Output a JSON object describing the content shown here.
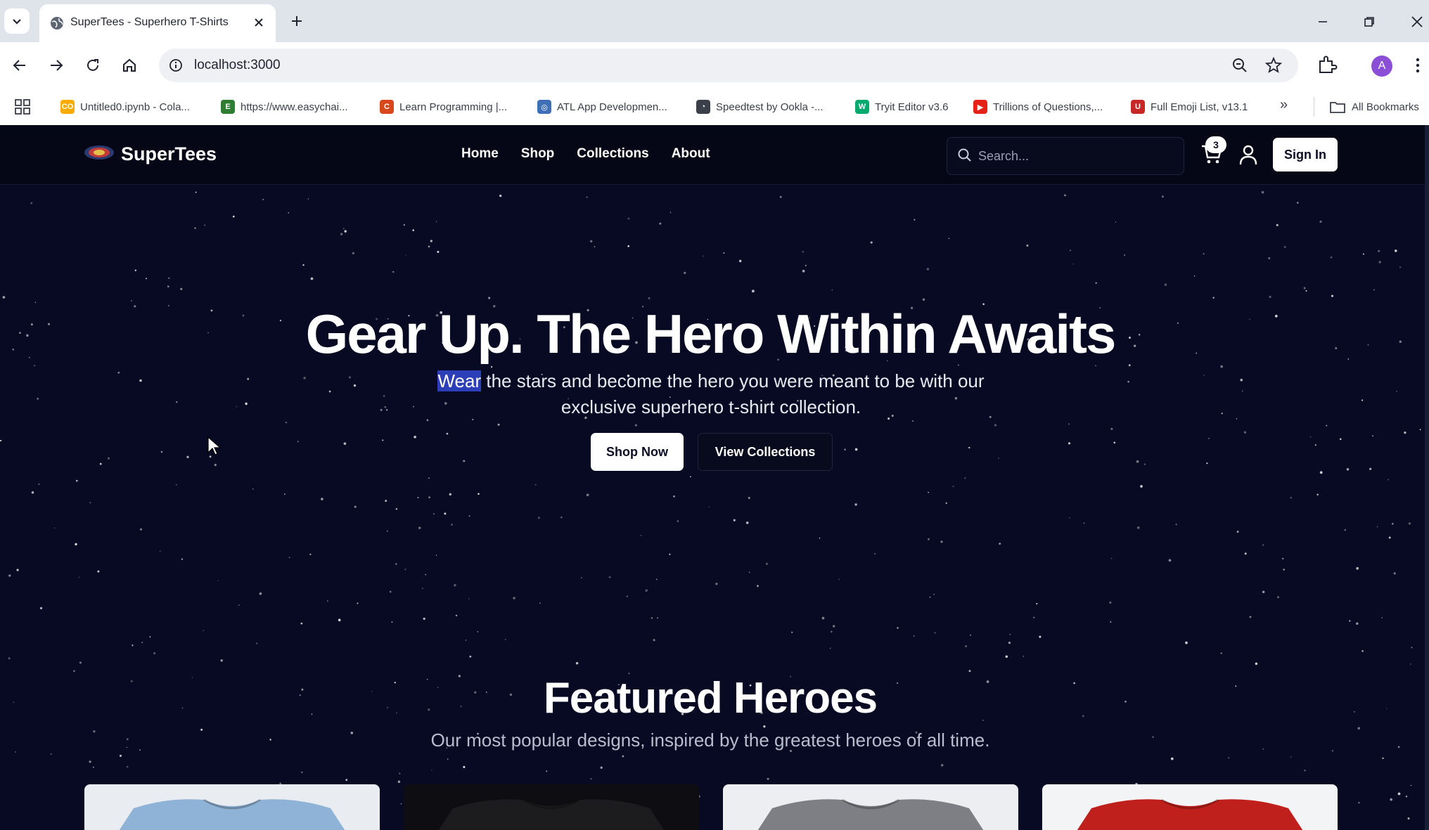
{
  "browser": {
    "tab_title": "SuperTees - Superhero T-Shirts",
    "url": "localhost:3000",
    "profile_initial": "A",
    "bookmarks": [
      {
        "label": "Untitled0.ipynb - Cola...",
        "icon": "colab-icon",
        "color": "#f9ab00"
      },
      {
        "label": "https://www.easychai...",
        "icon": "easychair-icon",
        "color": "#2e7d32"
      },
      {
        "label": "Learn Programming |...",
        "icon": "codecademy-icon",
        "color": "#d9481c"
      },
      {
        "label": "ATL App Developmen...",
        "icon": "globe-icon",
        "color": "#3f6fb5"
      },
      {
        "label": "Speedtest by Ookla -...",
        "icon": "speedtest-icon",
        "color": "#3a3f4a"
      },
      {
        "label": "Tryit Editor v3.6",
        "icon": "w3schools-icon",
        "color": "#04aa6d"
      },
      {
        "label": "Trillions of Questions,...",
        "icon": "youtube-icon",
        "color": "#e62117"
      },
      {
        "label": "Full Emoji List, v13.1",
        "icon": "unicode-icon",
        "color": "#c62828"
      }
    ],
    "all_bookmarks": "All Bookmarks"
  },
  "site": {
    "logo_text": "SuperTees",
    "nav": [
      "Home",
      "Shop",
      "Collections",
      "About"
    ],
    "search_placeholder": "Search...",
    "cart_count": "3",
    "sign_in": "Sign In"
  },
  "hero": {
    "title": "Gear Up. The Hero Within Awaits",
    "subtitle_highlight": "Wear",
    "subtitle_rest": " the stars and become the hero you were meant to be with our exclusive superhero t-shirt collection.",
    "primary_cta": "Shop Now",
    "secondary_cta": "View Collections"
  },
  "featured": {
    "title": "Featured Heroes",
    "subtitle": "Our most popular designs, inspired by the greatest heroes of all time.",
    "products": [
      {
        "icon": "light-blue-tshirt-image",
        "color": "#8fb3d6",
        "bg": "#e9ecf0"
      },
      {
        "icon": "black-tshirt-image",
        "color": "#1c1c1e",
        "bg": "#0d0d12"
      },
      {
        "icon": "grey-tshirt-image",
        "color": "#7d7f84",
        "bg": "#eceef1"
      },
      {
        "icon": "red-tshirt-image",
        "color": "#c0201b",
        "bg": "#f3f4f6"
      }
    ]
  },
  "colors": {
    "page_bg": "#070a22",
    "header_bg": "#050716",
    "highlight": "#2c3fb8"
  }
}
